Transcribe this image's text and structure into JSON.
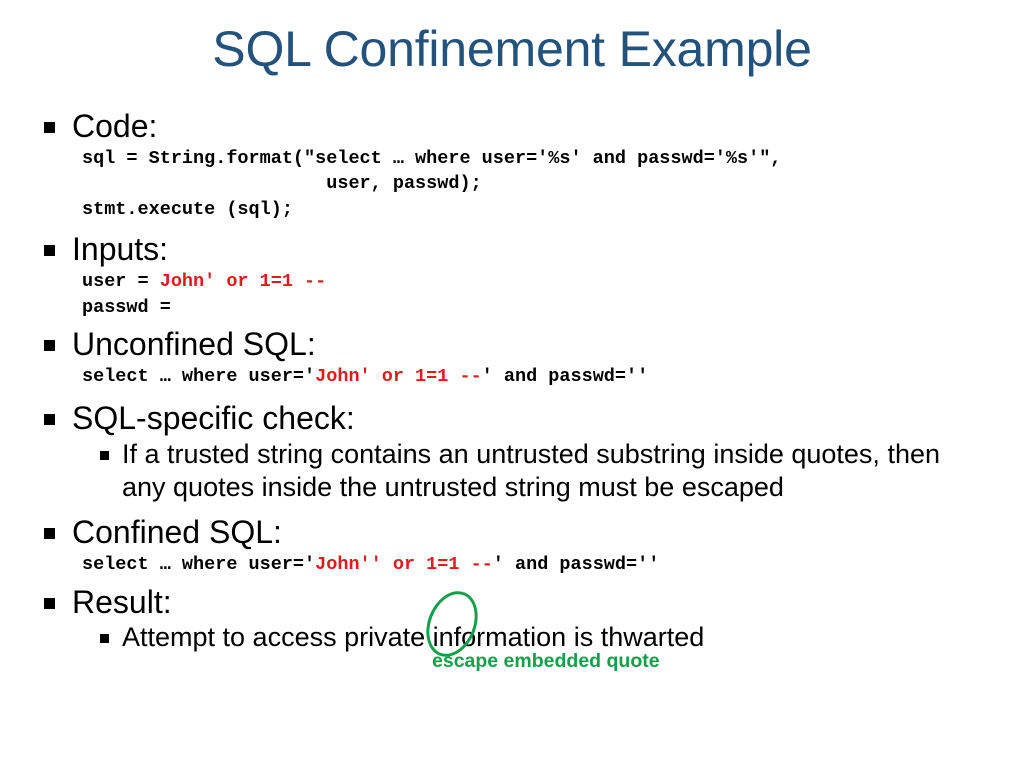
{
  "slide": {
    "title": "SQL Confinement Example",
    "title_color": "#23527c",
    "background_color": "#ffffff",
    "text_color": "#000000",
    "code_highlight_color": "#dd1c1c",
    "annotation_color": "#14a04a"
  },
  "sections": {
    "code": {
      "heading": "Code:",
      "line1_a": "sql = String.format(\"select … where user='%s' and passwd='%s'\",",
      "line2_a": "                      user, passwd);",
      "line3_a": "stmt.execute (sql);"
    },
    "inputs": {
      "heading": "Inputs:",
      "user_label": "user = ",
      "user_value": "John' or 1=1 --",
      "passwd_label": "passwd ="
    },
    "unconfined": {
      "heading": "Unconfined SQL:",
      "prefix": "select … where user='",
      "injected": "John' or 1=1 --",
      "suffix": "' and passwd=''"
    },
    "check": {
      "heading": "SQL-specific check:",
      "detail": "If a trusted string contains an untrusted substring inside quotes, then any quotes inside the untrusted string must be escaped"
    },
    "confined": {
      "heading": "Confined SQL:",
      "prefix": "select … where user='",
      "injected": "John'' or 1=1 --",
      "suffix": "' and passwd=''"
    },
    "result": {
      "heading": "Result:",
      "detail": "Attempt to access private information is thwarted"
    }
  },
  "annotation": {
    "caption": "escape embedded quote"
  }
}
